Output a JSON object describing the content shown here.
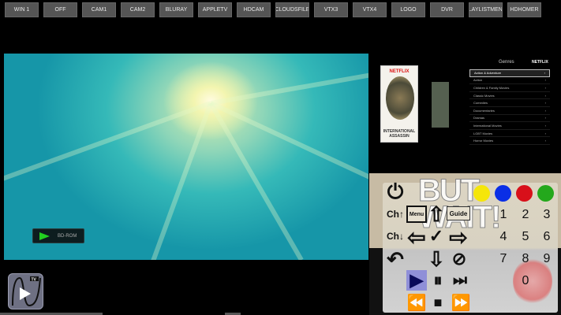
{
  "topbar": {
    "buttons": [
      "WIN 1",
      "OFF",
      "CAM1",
      "CAM2",
      "BLURAY",
      "APPLETV",
      "HDCAM",
      "CLOUDSFILE",
      "VTX3",
      "VTX4",
      "LOGO",
      "DVR",
      "PLAYLISTMENU",
      "HDHOMER"
    ]
  },
  "video": {
    "osd_label": "BD-ROM"
  },
  "netflix_menu": {
    "title": "Genres",
    "brand": "NETFLIX",
    "poster_brand": "NETFLIX",
    "poster_title": "INTERNATIONAL ASSASSIN",
    "genres": [
      "Action & Adventure",
      "Action",
      "Children & Family Movies",
      "Classic Movies",
      "Comedies",
      "Documentaries",
      "Dramas",
      "International Movies",
      "LGBT Movies",
      "Horror Movies"
    ],
    "selected": "Action & Adventure"
  },
  "remote": {
    "overlay_text": "BUT WAIT!",
    "ch_up": "Ch↑",
    "ch_down": "Ch↓",
    "menu": "Menu",
    "guide": "Guide",
    "numbers": [
      "1",
      "2",
      "3",
      "4",
      "5",
      "6",
      "7",
      "8",
      "9",
      "0"
    ],
    "color_buttons": [
      "#f5e60a",
      "#0a2ee6",
      "#d8101a",
      "#24a81c"
    ]
  }
}
